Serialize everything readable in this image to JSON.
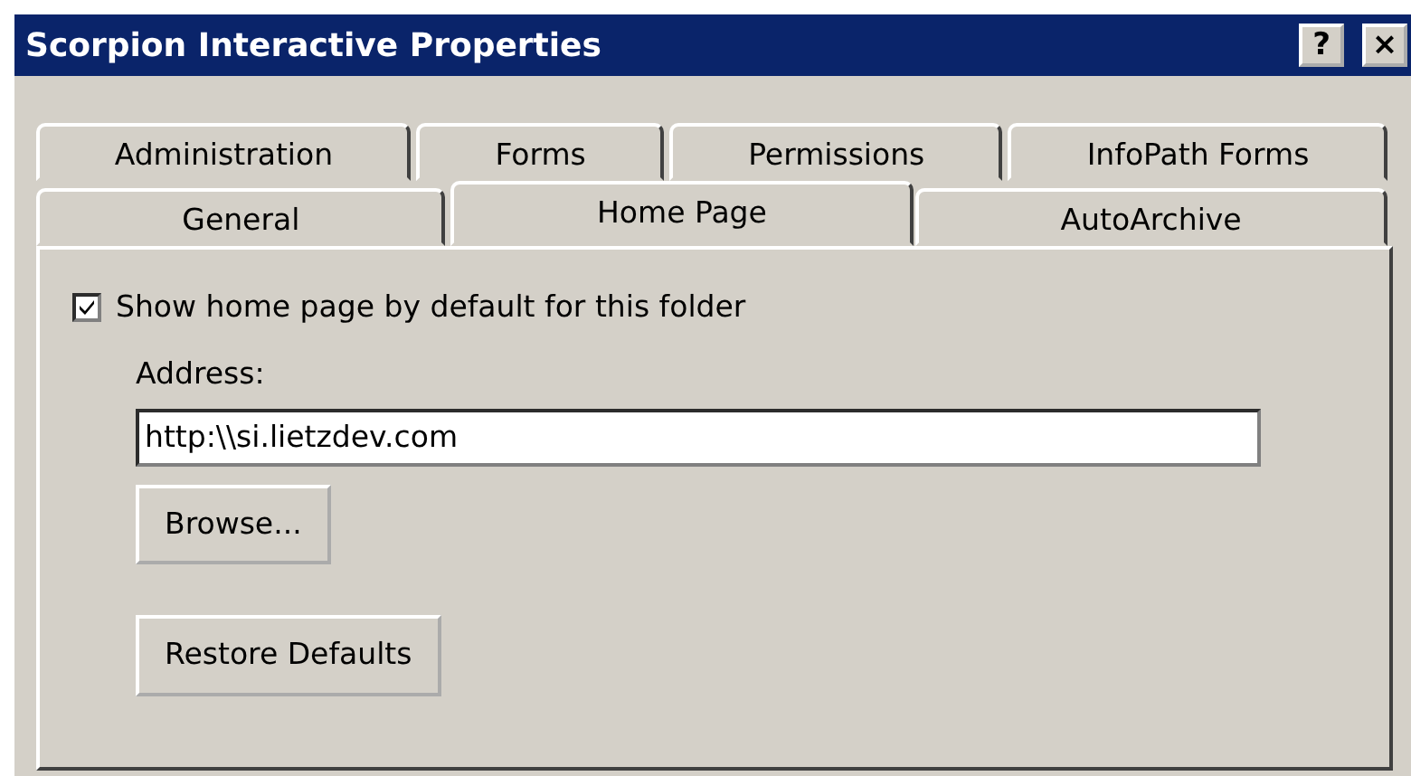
{
  "window": {
    "title": "Scorpion Interactive Properties",
    "title_buttons": [
      "?",
      "×"
    ]
  },
  "tab_rows": [
    {
      "tabs": [
        {
          "label": "Administration",
          "selected": false
        },
        {
          "label": "Forms",
          "selected": false
        },
        {
          "label": "Permissions",
          "selected": false
        },
        {
          "label": "InfoPath Forms",
          "selected": false
        }
      ]
    },
    {
      "tabs": [
        {
          "label": "General",
          "selected": false
        },
        {
          "label": "Home Page",
          "selected": true
        },
        {
          "label": "AutoArchive",
          "selected": false
        }
      ]
    }
  ],
  "show_home_page": {
    "label": "Show home page by default for this folder",
    "checked": true
  },
  "address": {
    "label": "Address:",
    "value": "http:\\\\si.lietzdev.com"
  },
  "buttons": [
    "Browse...",
    "Restore Defaults"
  ]
}
